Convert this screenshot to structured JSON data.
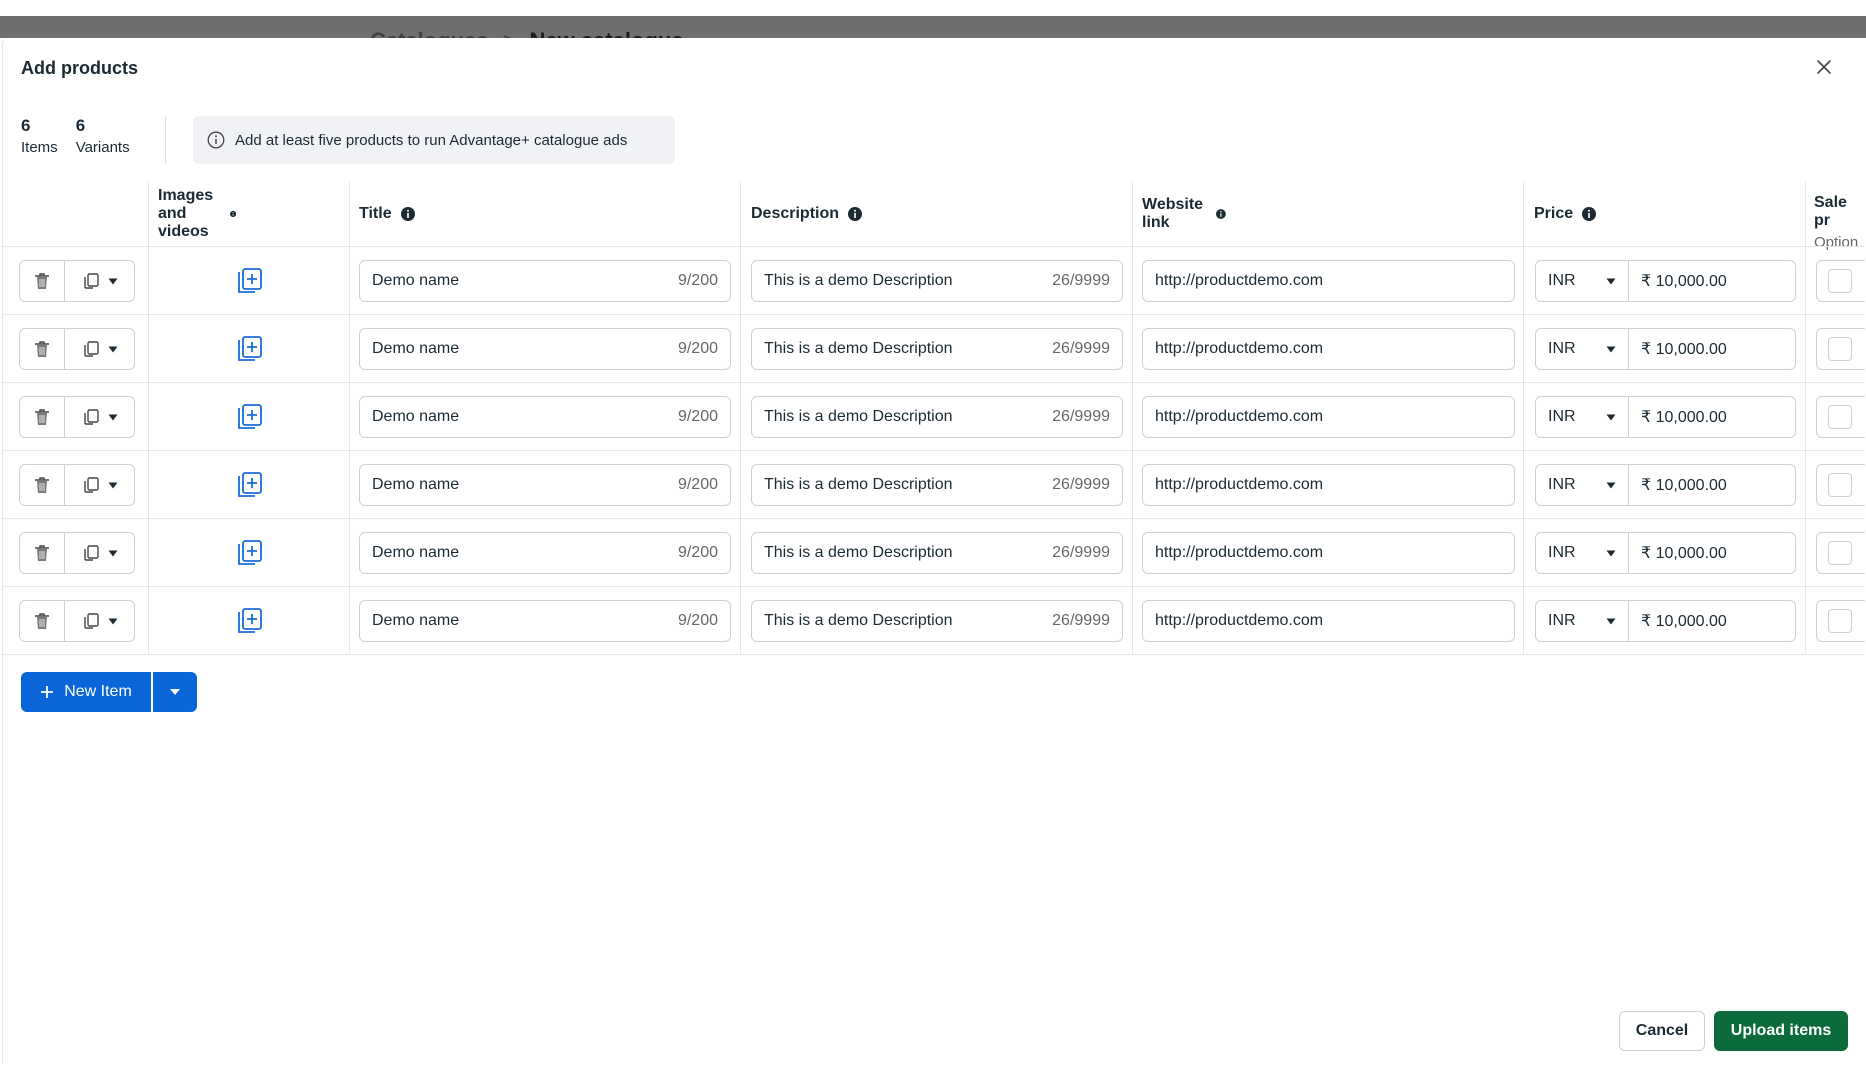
{
  "breadcrumb": {
    "parent": "Catalogues",
    "separator": ">",
    "current": "New catalogue"
  },
  "modal": {
    "title": "Add products"
  },
  "stats": {
    "items_count": "6",
    "items_label": "Items",
    "variants_count": "6",
    "variants_label": "Variants"
  },
  "info_banner": {
    "text": "Add at least five products to run Advantage+ catalogue ads"
  },
  "columns": {
    "images": "Images and videos",
    "title": "Title",
    "description": "Description",
    "website": "Website link",
    "price": "Price",
    "sale": "Sale pr",
    "sale_sub": "Option"
  },
  "rows": [
    {
      "title": "Demo name",
      "title_count": "9/200",
      "description": "This is a demo Description",
      "description_count": "26/9999",
      "link": "http://productdemo.com",
      "currency": "INR",
      "price": "₹ 10,000.00"
    },
    {
      "title": "Demo name",
      "title_count": "9/200",
      "description": "This is a demo Description",
      "description_count": "26/9999",
      "link": "http://productdemo.com",
      "currency": "INR",
      "price": "₹ 10,000.00"
    },
    {
      "title": "Demo name",
      "title_count": "9/200",
      "description": "This is a demo Description",
      "description_count": "26/9999",
      "link": "http://productdemo.com",
      "currency": "INR",
      "price": "₹ 10,000.00"
    },
    {
      "title": "Demo name",
      "title_count": "9/200",
      "description": "This is a demo Description",
      "description_count": "26/9999",
      "link": "http://productdemo.com",
      "currency": "INR",
      "price": "₹ 10,000.00"
    },
    {
      "title": "Demo name",
      "title_count": "9/200",
      "description": "This is a demo Description",
      "description_count": "26/9999",
      "link": "http://productdemo.com",
      "currency": "INR",
      "price": "₹ 10,000.00"
    },
    {
      "title": "Demo name",
      "title_count": "9/200",
      "description": "This is a demo Description",
      "description_count": "26/9999",
      "link": "http://productdemo.com",
      "currency": "INR",
      "price": "₹ 10,000.00"
    }
  ],
  "actions": {
    "new_item": "New Item",
    "cancel": "Cancel",
    "upload": "Upload items"
  },
  "icons": {
    "close": "close-icon",
    "info": "info-icon",
    "delete": "trash-icon",
    "duplicate": "copy-icon",
    "media": "add-media-icon",
    "caret": "caret-down-icon",
    "plus": "plus-icon"
  },
  "colors": {
    "primary": "#0a66d8",
    "upload": "#0b6b3a",
    "border": "#ced0d4",
    "text": "#1c2b33"
  }
}
